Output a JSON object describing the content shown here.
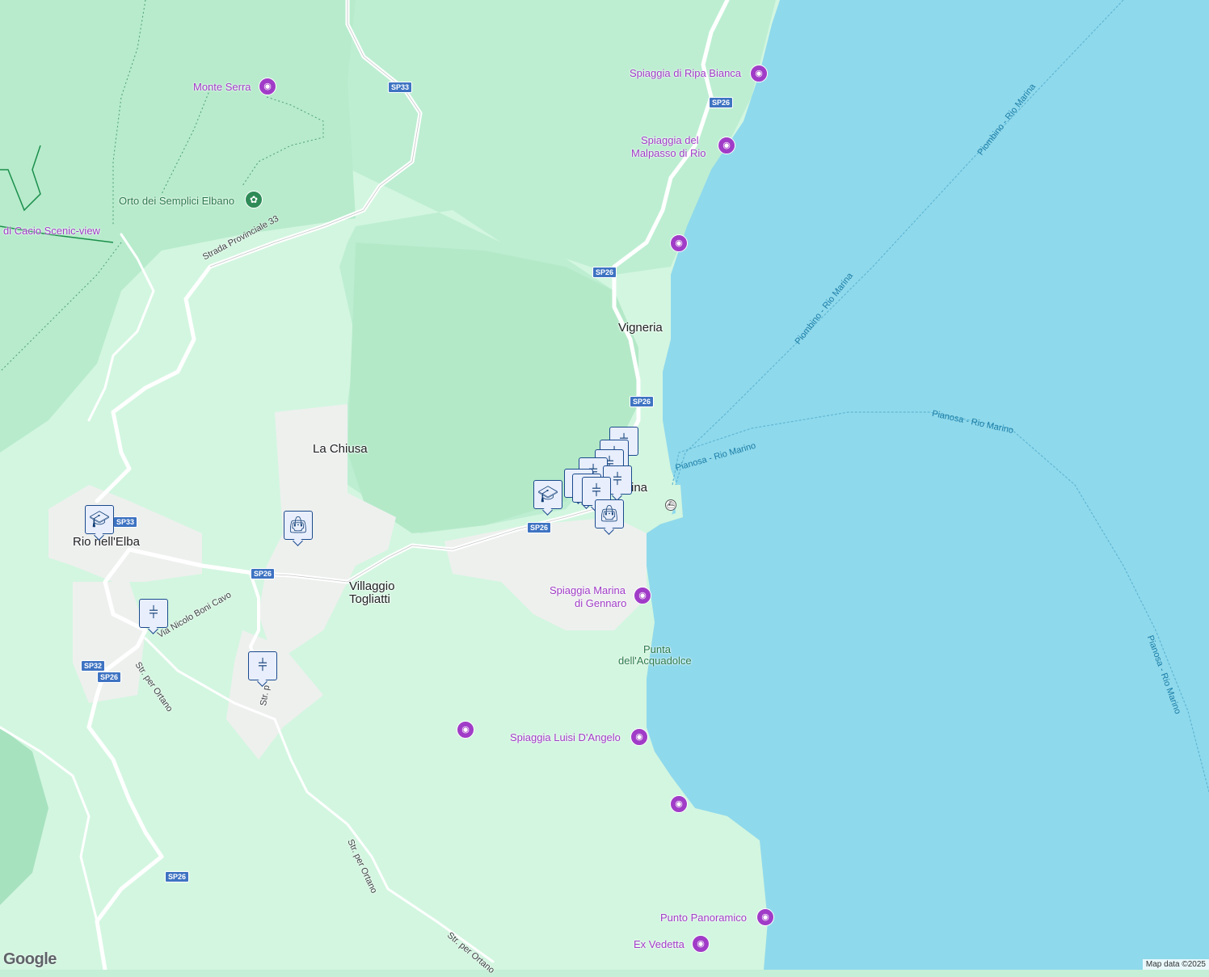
{
  "places": {
    "vigneria": "Vigneria",
    "la_chiusa": "La Chiusa",
    "rio_nell_elba": "Rio nell'Elba",
    "villaggio_1": "Villaggio",
    "villaggio_2": "Togliatti",
    "rio_marina_partial": "ina"
  },
  "pois": {
    "monte_serra": "Monte Serra",
    "ripa_bianca": "Spiaggia di Ripa Bianca",
    "malpasso_1": "Spiaggia del",
    "malpasso_2": "Malpasso di Rio",
    "marina_gennaro_1": "Spiaggia Marina",
    "marina_gennaro_2": "di Gennaro",
    "luisi": "Spiaggia Luisi D'Angelo",
    "panoramico": "Punto Panoramico",
    "vedetta": "Ex Vedetta",
    "cacio": "di Cacio Scenic-view"
  },
  "nature": {
    "orto": "Orto dei Semplici Elbano",
    "punta_1": "Punta",
    "punta_2": "dell'Acquadolce"
  },
  "ferry_routes": {
    "piombino_1": "Piombino - Rio Marina",
    "piombino_2": "Piombino - Rio Marina",
    "pianosa_1": "Pianosa - Rio Marino",
    "pianosa_2": "Pianosa - Rio Marino",
    "pianosa_3": "Pianosa - Rio Marino"
  },
  "roads": {
    "sp33_name": "Strada Provinciale 33",
    "boni_cavo": "Via Nicolo Boni Cavo",
    "ortano_1": "Str. per Ortano",
    "ortano_2": "Str. per Ortano",
    "ortano_3": "Str. per Ortano",
    "ortano_4": "Str. p"
  },
  "shields": {
    "sp33_top": "SP33",
    "sp26_a": "SP26",
    "sp26_b": "SP26",
    "sp26_c": "SP26",
    "sp26_d": "SP26",
    "sp26_e": "SP26",
    "sp33_b": "SP33",
    "sp32": "SP32",
    "sp26_f": "SP26",
    "sp26_g": "SP26"
  },
  "icons": {
    "camera": "camera-icon",
    "flower": "garden-icon",
    "restaurant": "restaurant-icon",
    "shopping": "shopping-bag-icon",
    "school": "school-icon",
    "ferry": "ferry-terminal-icon"
  },
  "colors": {
    "sea": "#8fd9ec",
    "forest": "#b9ecce",
    "land": "#d3f6e0",
    "urban": "#eef0ee",
    "poi": "#a03cc7",
    "pin_border": "#1a4a8c"
  },
  "branding": {
    "logo": "Google",
    "attribution": "Map data ©2025"
  }
}
